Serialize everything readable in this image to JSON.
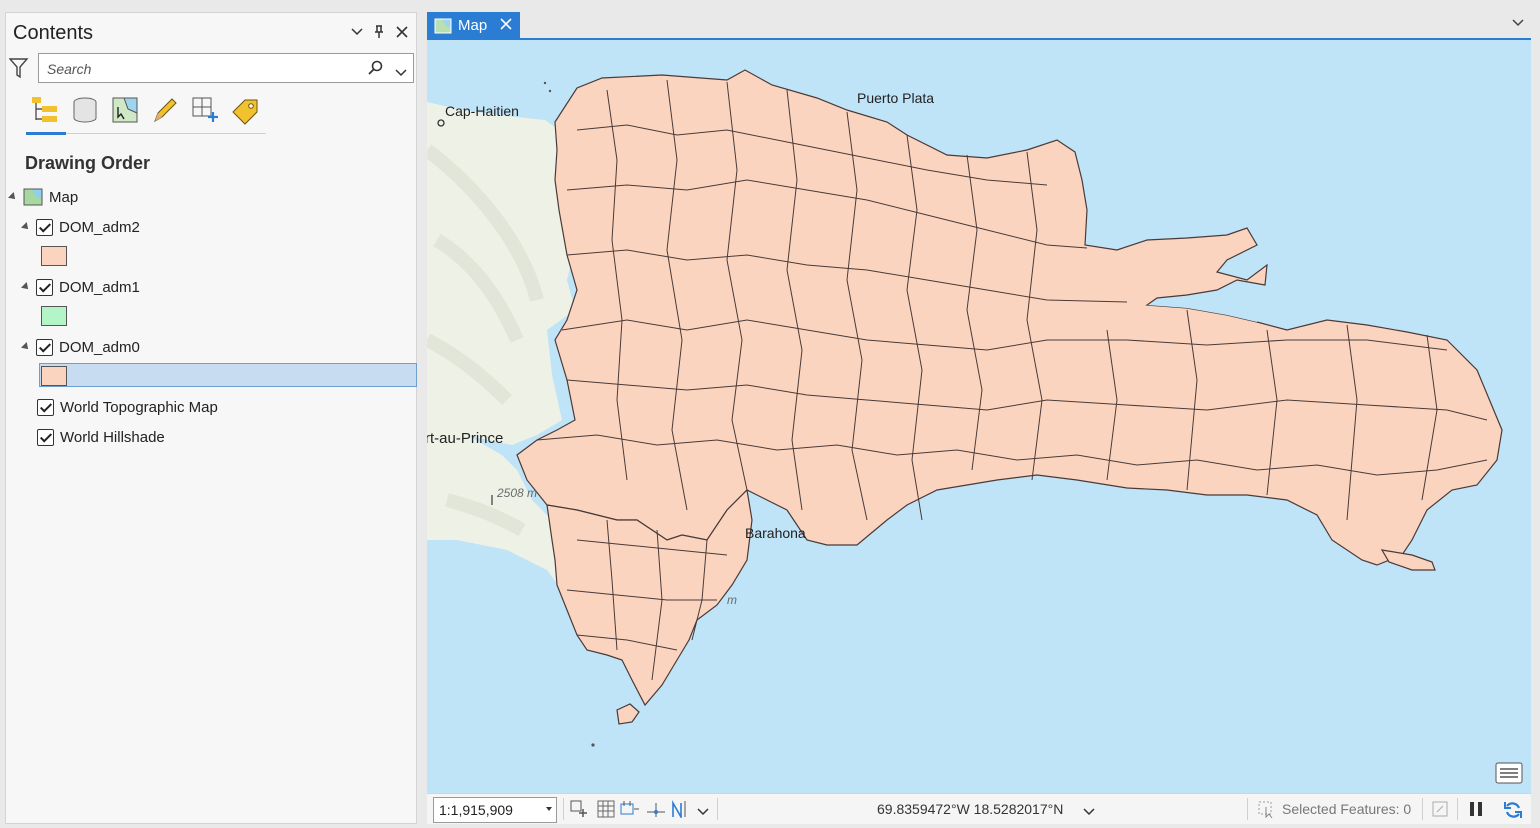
{
  "contents_pane": {
    "title": "Contents",
    "search": {
      "placeholder": "Search",
      "value": ""
    },
    "toolbar_icons": [
      "list-by-drawing-order-icon",
      "list-by-source-icon",
      "list-by-selection-icon",
      "list-by-editing-icon",
      "list-by-snapping-icon",
      "list-by-labeling-icon"
    ],
    "section_title": "Drawing Order",
    "tree": {
      "map_label": "Map",
      "layers": [
        {
          "name": "DOM_adm2",
          "checked": true,
          "expanded": true,
          "swatch": "#fbd4c0"
        },
        {
          "name": "DOM_adm1",
          "checked": true,
          "expanded": true,
          "swatch": "#b4f5c8"
        },
        {
          "name": "DOM_adm0",
          "checked": true,
          "expanded": true,
          "swatch": "#fbd4c0",
          "selected": true
        },
        {
          "name": "World Topographic Map",
          "checked": true
        },
        {
          "name": "World Hillshade",
          "checked": true
        }
      ]
    }
  },
  "map_view": {
    "tab_label": "Map",
    "labels": {
      "cap_haitien": "Cap-Haitien",
      "puerto_plata": "Puerto Plata",
      "port_au_prince": "rt-au-Prince",
      "barahona": "Barahona",
      "elevation": "2508 m",
      "m_mark": "m"
    },
    "colors": {
      "water": "#bfe3f7",
      "land_fill": "#fbd4c0",
      "boundary": "#4a3a38",
      "haiti": "#eef2e6",
      "accent": "#2b7cd3"
    }
  },
  "status_bar": {
    "scale": "1:1,915,909",
    "coordinates": "69.8359472°W 18.5282017°N",
    "selected_features": "Selected Features: 0"
  }
}
